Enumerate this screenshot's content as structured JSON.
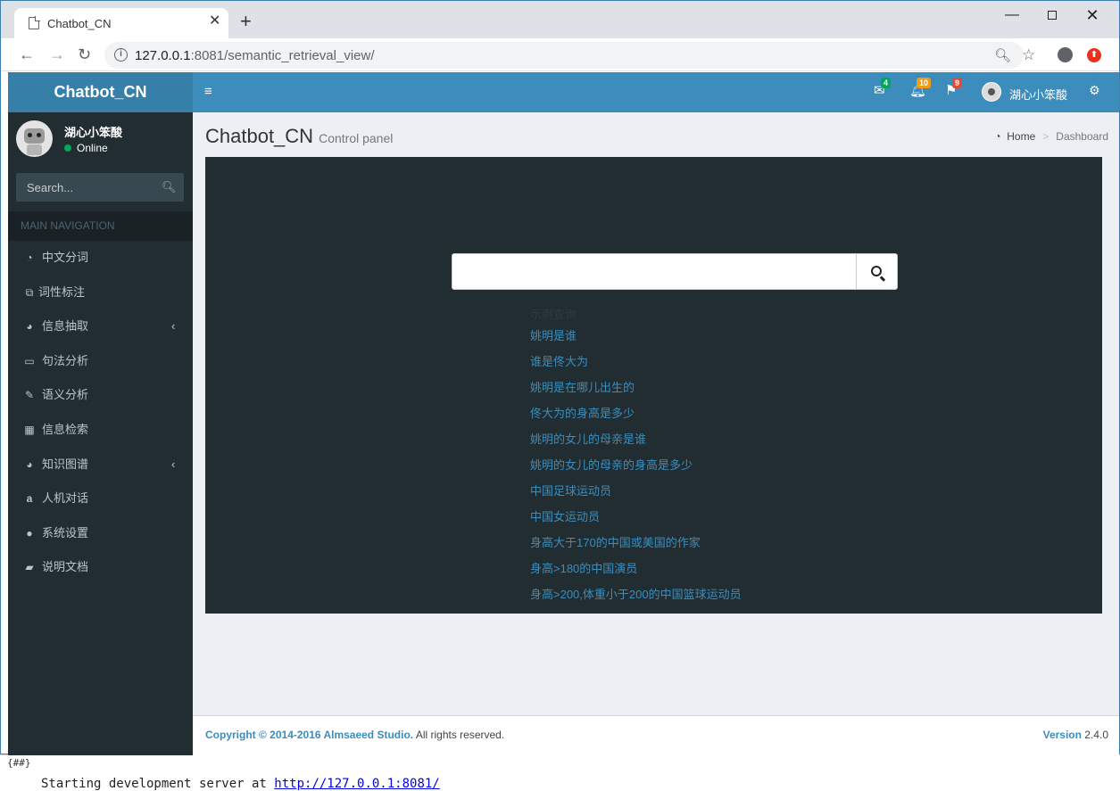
{
  "browser": {
    "tab_title": "Chatbot_CN",
    "new_tab_symbol": "+",
    "url_host": "127.0.0.1",
    "url_path": ":8081/semantic_retrieval_view/"
  },
  "app": {
    "logo": "Chatbot_CN",
    "notifications": {
      "messages": "4",
      "alerts": "10",
      "flags": "9"
    },
    "colors": {
      "header": "#3c8dbc",
      "logo": "#367fa9",
      "sidebar": "#222d32",
      "msg_badge": "#00a65a",
      "alert_badge": "#f39c12",
      "flag_badge": "#dd4b39"
    },
    "user_name": "湖心小笨酸"
  },
  "sidebar": {
    "user_name": "湖心小笨酸",
    "status": "Online",
    "search_placeholder": "Search...",
    "section_header": "MAIN NAVIGATION",
    "items": [
      {
        "label": "中文分词",
        "icon": "dashboard-icon",
        "chevron": false
      },
      {
        "label": "词性标注",
        "icon": "copy-icon",
        "chevron": false
      },
      {
        "label": "信息抽取",
        "icon": "pie-chart-icon",
        "chevron": true
      },
      {
        "label": "句法分析",
        "icon": "laptop-icon",
        "chevron": false
      },
      {
        "label": "语义分析",
        "icon": "edit-icon",
        "chevron": false
      },
      {
        "label": "信息检索",
        "icon": "table-icon",
        "chevron": false
      },
      {
        "label": "知识图谱",
        "icon": "pie-chart-icon",
        "chevron": true
      },
      {
        "label": "人机对话",
        "icon": "amazon-icon",
        "chevron": false
      },
      {
        "label": "系统设置",
        "icon": "compass-icon",
        "chevron": false
      },
      {
        "label": "说明文档",
        "icon": "book-icon",
        "chevron": false
      }
    ]
  },
  "content": {
    "title": "Chatbot_CN",
    "subtitle": "Control panel",
    "breadcrumb_home": "Home",
    "breadcrumb_current": "Dashboard",
    "examples_title": "示例查询",
    "examples": [
      "姚明是谁",
      "谁是佟大为",
      "姚明是在哪儿出生的",
      "佟大为的身高是多少",
      "姚明的女儿的母亲是谁",
      "姚明的女儿的母亲的身高是多少",
      "中国足球运动员",
      "中国女运动员",
      "身高大于170的中国或美国的作家",
      "身高>180的中国演员",
      "身高>200,体重小于200的中国篮球运动员"
    ]
  },
  "footer": {
    "copyright_strong": "Copyright © 2014-2016 Almsaeed Studio.",
    "copyright_rest": " All rights reserved.",
    "version_label": "Version",
    "version_number": " 2.4.0"
  },
  "desktop": {
    "tag": "{##}",
    "terminal_prefix": "Starting development server at ",
    "terminal_url": "http://127.0.0.1:8081/"
  }
}
